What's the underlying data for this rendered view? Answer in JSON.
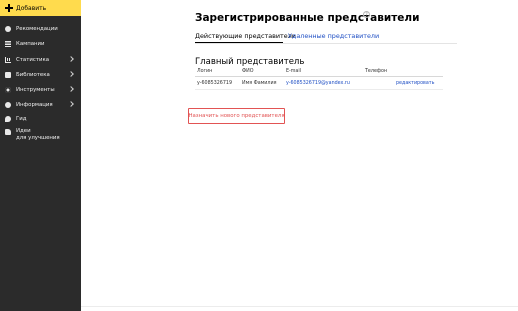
{
  "sidebar": {
    "add_label": "Добавить",
    "items": [
      {
        "label": "Рекомендации",
        "icon": "bulb-icon"
      },
      {
        "label": "Кампании",
        "icon": "list-icon"
      },
      {
        "label": "Статистика",
        "icon": "chart-icon"
      },
      {
        "label": "Библиотека",
        "icon": "library-icon"
      },
      {
        "label": "Инструменты",
        "icon": "tools-icon"
      },
      {
        "label": "Информация",
        "icon": "info-icon"
      },
      {
        "label": "Гид",
        "icon": "guide-icon"
      },
      {
        "label_line1": "Идеи",
        "label_line2": "для улучшения",
        "icon": "like-icon"
      }
    ]
  },
  "page": {
    "title": "Зарегистрированные представители",
    "help": "?"
  },
  "tabs": {
    "active": "Действующие представители",
    "deleted": "Удаленные представители"
  },
  "section": {
    "title": "Главный представитель"
  },
  "table": {
    "headers": [
      "Логин",
      "ФИО",
      "E-mail",
      "Телефон"
    ],
    "row": {
      "login": "y-6085326719",
      "fio": "Имя Фамилия",
      "email": "y-6085326719@yandex.ru",
      "phone": "",
      "edit": "редактировать"
    }
  },
  "actions": {
    "assign_label": "Назначить нового представителя"
  },
  "colors": {
    "accent_yellow": "#ffdb4d",
    "sidebar_bg": "#2b2b2b",
    "link_blue": "#1f4fc4",
    "assign_red": "#e25353"
  }
}
